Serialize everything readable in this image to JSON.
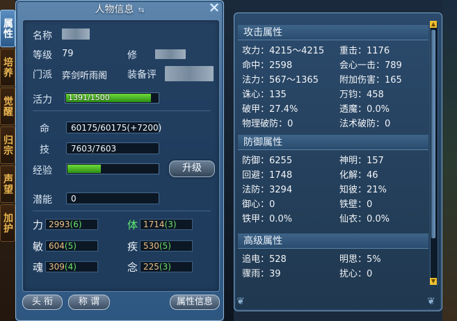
{
  "side_tabs": [
    "属性",
    "培养",
    "觉醒",
    "归宗",
    "声望",
    "加护"
  ],
  "window": {
    "title": "人物信息",
    "title_icon": "sort-arrows-icon",
    "close_icon": "close-icon"
  },
  "profile": {
    "name_label": "名称",
    "level_label": "等级",
    "level_value": "79",
    "cultivation_label": "修",
    "sect_label": "门派",
    "sect_value": "弈剑听雨阁",
    "equip_label": "装备评"
  },
  "vitality": {
    "label": "活力",
    "text": "1391/1500",
    "fraction": 0.927
  },
  "resources": {
    "hp_label": "命",
    "hp_value": "60175/60175(+7200)",
    "skill_label": "技",
    "skill_value": "7603/7603",
    "exp_label": "经验",
    "exp_fraction": 0.38,
    "upgrade_label": "升级",
    "potential_label": "潜能",
    "potential_value": "0"
  },
  "stats": [
    {
      "label": "力",
      "value": "2993",
      "bonus": "(6)",
      "highlight": false
    },
    {
      "label": "体",
      "value": "1714",
      "bonus": "(3)",
      "highlight": true
    },
    {
      "label": "敏",
      "value": "604",
      "bonus": "(5)",
      "highlight": false
    },
    {
      "label": "疾",
      "value": "530",
      "bonus": "(5)",
      "highlight": false
    },
    {
      "label": "魂",
      "value": "309",
      "bonus": "(4)",
      "highlight": false
    },
    {
      "label": "念",
      "value": "225",
      "bonus": "(3)",
      "highlight": false
    }
  ],
  "bottom_buttons": {
    "title": "头 衔",
    "appellation": "称 谓",
    "attributes": "属性信息"
  },
  "attack": {
    "header": "攻击属性",
    "rows": [
      [
        "攻力：4215～4215",
        "重击：1176"
      ],
      [
        "命中：2598",
        "会心一击：789"
      ],
      [
        "法力：567～1365",
        "附加伤害：165"
      ],
      [
        "诛心：135",
        "万钧：458"
      ],
      [
        "破甲：27.4%",
        "透魔：0.0%"
      ],
      [
        "物理破防：0",
        "法术破防：0"
      ]
    ]
  },
  "defense": {
    "header": "防御属性",
    "rows": [
      [
        "防御：6255",
        "神明：157"
      ],
      [
        "回避：1748",
        "化解：46"
      ],
      [
        "法防：3294",
        "知彼：21%"
      ],
      [
        "御心：0",
        "铁壁：0"
      ],
      [
        "铁甲：0.0%",
        "仙衣：0.0%"
      ]
    ]
  },
  "advanced": {
    "header": "高级属性",
    "rows": [
      [
        "追电：528",
        "明思：5%"
      ],
      [
        "骤雨：39",
        "扰心：0"
      ]
    ]
  },
  "colors": {
    "accent_green": "#5cf06a",
    "stat_value": "#f0c080",
    "bar_green": "#4cc42a",
    "scroll_yellow": "#f1c232"
  }
}
